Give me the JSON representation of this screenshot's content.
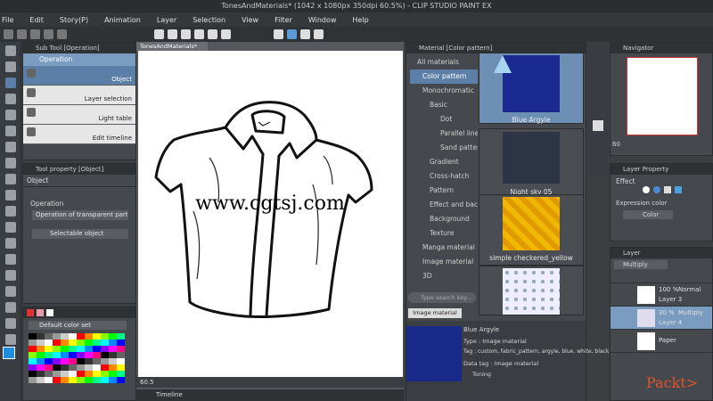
{
  "window": {
    "title": "TonesAndMaterials* (1042 x 1080px 350dpi 60.5%) - CLIP STUDIO PAINT EX"
  },
  "menu": [
    "File",
    "Edit",
    "Story(P)",
    "Animation",
    "Layer",
    "Selection",
    "View",
    "Filter",
    "Window",
    "Help"
  ],
  "subtool": {
    "tab": "Sub Tool [Operation]",
    "group": "Operation",
    "items": [
      "Object",
      "Layer selection",
      "Light table",
      "Edit timeline"
    ]
  },
  "toolprop": {
    "tab": "Tool property [Object]",
    "title": "Object",
    "section": "Operation",
    "dropdown1": "Operation of transparent part",
    "dropdown2": "Selectable object"
  },
  "colorset": {
    "selected": "Default color set"
  },
  "canvas": {
    "tab": "TonesAndMaterials*",
    "zoom": "60.5",
    "timeline_tab": "Timeline"
  },
  "watermark": "www.cgtsj.com",
  "material": {
    "tab": "Material [Color pattern]",
    "tree": [
      "All materials",
      "Color pattern",
      "Monochromatic",
      "Basic",
      "Dot",
      "Parallel line",
      "Sand pattern",
      "Gradient",
      "Cross-hatch",
      "Pattern",
      "Effect and background",
      "Background",
      "Texture",
      "Manga material",
      "Image material",
      "3D"
    ],
    "search_placeholder": "Type search key...",
    "tag": "Image material",
    "thumbs": [
      "Blue Argyle",
      "Night sky 05",
      "simple checkered_yellow",
      ""
    ],
    "detail": {
      "name": "Blue Argyle",
      "type": "Type : Image material",
      "tags": "Tag : custom, fabric_pattern, argyle, blue, white, black",
      "data_tag": "Data tag : Image material",
      "toning": "Toning"
    }
  },
  "navigator": {
    "tab": "Navigator",
    "zoom": "60"
  },
  "layerprop": {
    "tab": "Layer Property",
    "effect": "Effect",
    "expression_label": "Expression color",
    "expression_value": "Color"
  },
  "layers": {
    "tab": "Layer",
    "blend": "Multiply",
    "rows": [
      {
        "pct": "100 %",
        "mode": "Normal",
        "name": "Layer 3"
      },
      {
        "pct": "30 %",
        "mode": "Multiply",
        "name": "Layer 4"
      },
      {
        "pct": "",
        "mode": "",
        "name": "Paper"
      }
    ]
  },
  "logo": "Packt>",
  "colors": {
    "accent": "#5b7fa6",
    "watermark": "#1b6fd1",
    "logo": "#e0552a"
  }
}
